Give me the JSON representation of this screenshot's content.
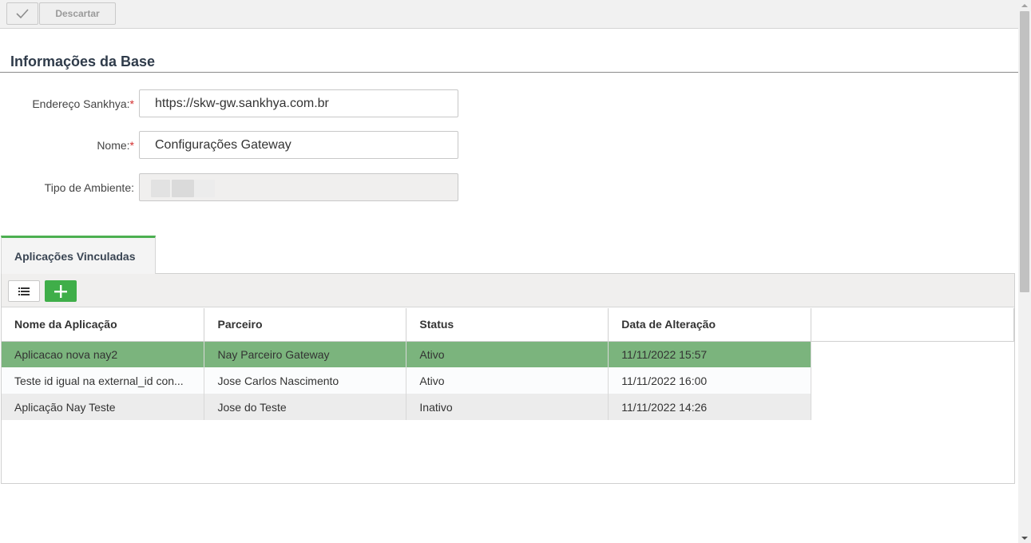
{
  "toolbar": {
    "confirm_icon": "check-icon",
    "discard_label": "Descartar"
  },
  "section": {
    "title": "Informações da Base"
  },
  "form": {
    "address": {
      "label": "Endereço Sankhya:",
      "required": "*",
      "value": "https://skw-gw.sankhya.com.br"
    },
    "name": {
      "label": "Nome:",
      "required": "*",
      "value": "Configurações Gateway"
    },
    "env_type": {
      "label": "Tipo de Ambiente:",
      "value": ""
    }
  },
  "tabs": [
    {
      "label": "Aplicações Vinculadas",
      "active": true,
      "accent": "#4caf50"
    }
  ],
  "grid": {
    "toolbar": {
      "list_icon": "list-icon",
      "add_icon": "plus-icon",
      "add_color": "#3fae49"
    },
    "columns": [
      "Nome da Aplicação",
      "Parceiro",
      "Status",
      "Data de Alteração"
    ],
    "rows": [
      {
        "app": "Aplicacao nova nay2",
        "partner": "Nay Parceiro Gateway",
        "status": "Ativo",
        "date": "11/11/2022 15:57",
        "selected": true
      },
      {
        "app": "Teste id igual na external_id con...",
        "partner": "Jose Carlos Nascimento",
        "status": "Ativo",
        "date": "11/11/2022 16:00"
      },
      {
        "app": "Aplicação Nay Teste",
        "partner": "Jose do Teste",
        "status": "Inativo",
        "date": "11/11/2022 14:26"
      }
    ],
    "selected_color": "#7bb47d"
  }
}
